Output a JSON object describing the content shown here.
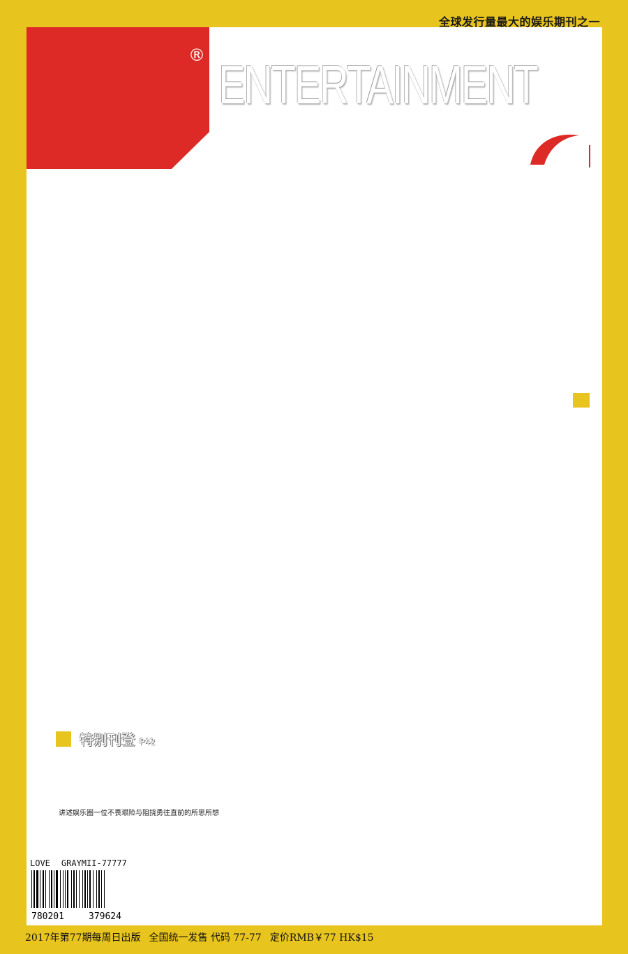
{
  "top_tagline": "全球发行量最大的娱乐期刊之一",
  "masthead": {
    "title": "ENTERTAINMENT",
    "registered_mark": "®"
  },
  "feature": {
    "label": "特别刊登",
    "page": "P42"
  },
  "description": "讲述娱乐圈一位不畏艰险与阻挠勇往直前的所思所想",
  "barcode": {
    "top_left": "LOVE",
    "top_right": "GRAYMII-77777",
    "number_left": "780201",
    "number_right": "379624"
  },
  "bottom_info": {
    "issue": "2017年第77期每周日出版",
    "distribution": "全国统一发售 代码 77-77",
    "price": "定价RMB￥77 HK$15"
  },
  "colors": {
    "frame": "#E8C41E",
    "accent_red": "#DE2A26",
    "panel": "#FFFFFF"
  }
}
